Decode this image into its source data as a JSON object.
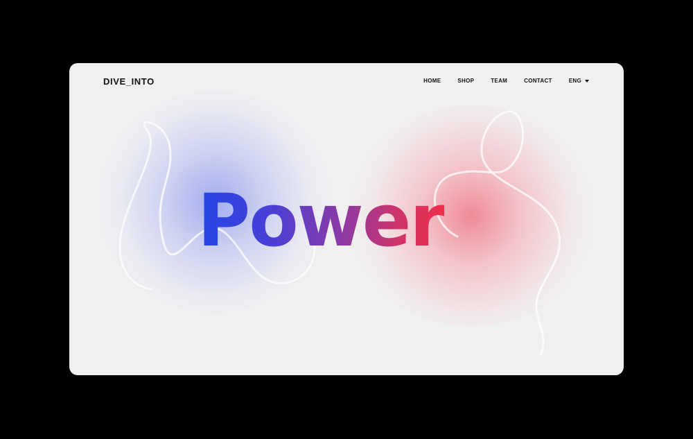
{
  "brand": {
    "logo": "DIVE_INTO"
  },
  "nav": {
    "items": [
      {
        "label": "HOME"
      },
      {
        "label": "SHOP"
      },
      {
        "label": "TEAM"
      },
      {
        "label": "CONTACT"
      }
    ],
    "language": {
      "label": "ENG",
      "icon": "caret-down-icon"
    }
  },
  "hero": {
    "headline": "Power"
  },
  "colors": {
    "background": "#000000",
    "card": "#f0f0f1",
    "gradient_start": "#2346e6",
    "gradient_end": "#ec2f4a",
    "glow_blue": "#96a0f0",
    "glow_red": "#f07887",
    "text": "#111111"
  }
}
